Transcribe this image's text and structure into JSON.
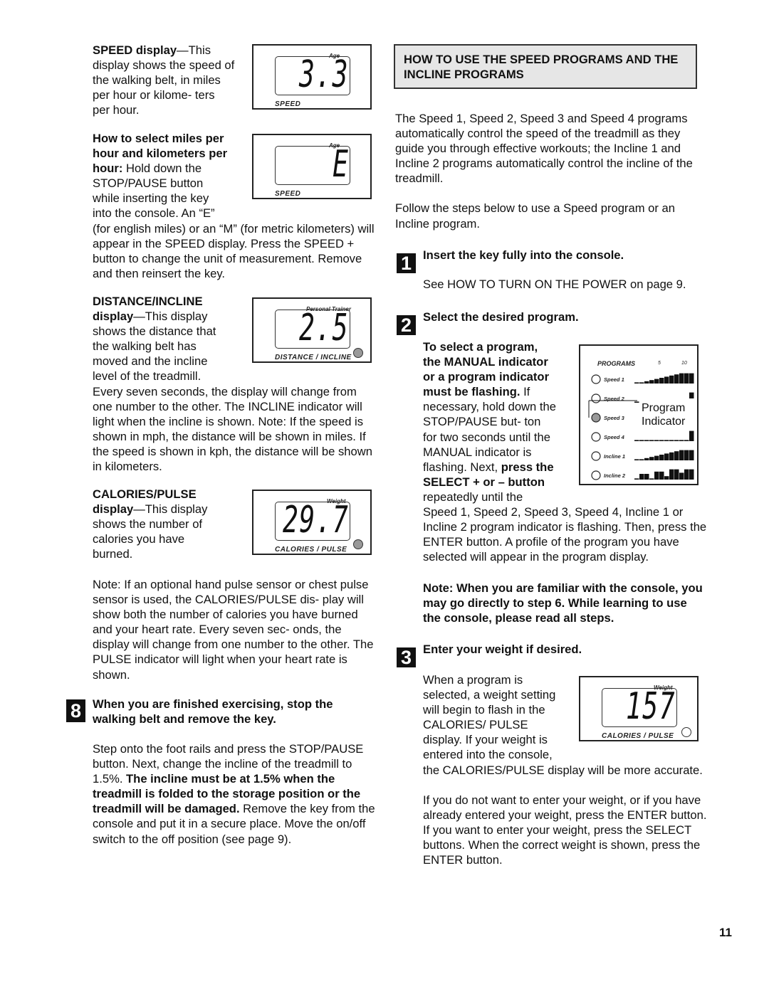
{
  "page_number": "11",
  "left": {
    "speed_display": {
      "heading": "SPEED display",
      "body": "—This display shows the speed of the walking belt, in miles per hour or kilome- ters per hour.",
      "figure1": {
        "top_label": "Age",
        "digits": "3.3",
        "bottom_label": "SPEED"
      },
      "figure2": {
        "top_label": "Age",
        "digits": "E",
        "bottom_label": "SPEED"
      }
    },
    "units": {
      "bold": "How to select miles per hour and kilometers per hour:",
      "body": " Hold down the STOP/PAUSE button while inserting the key into the console. An “E” (for english miles) or an “M” (for metric kilometers) will appear in the SPEED display. Press the SPEED + button to change the unit of measurement. Remove and then reinsert the key."
    },
    "distance": {
      "heading": "DISTANCE/INCLINE",
      "heading2": "display",
      "body": "—This display shows the distance that the walking belt has moved and the incline level of the treadmill.",
      "body2": "Every seven seconds, the display will change from one number to the other. The INCLINE indicator will light when the incline is shown. Note: If the speed is shown in mph, the distance will be shown in miles. If the speed is shown in kph, the distance will be shown in kilometers.",
      "figure": {
        "top_label": "Personal Trainer",
        "digits": "2.5",
        "bottom_label": "DISTANCE / INCLINE"
      }
    },
    "calories": {
      "heading": "CALORIES/PULSE",
      "heading2": "display",
      "body": "—This display shows the number of calories you have burned.",
      "figure": {
        "top_label": "Weight",
        "digits": "29.7",
        "bottom_label": "CALORIES / PULSE"
      },
      "note": "Note: If an optional hand pulse sensor or chest pulse sensor is used, the CALORIES/PULSE dis- play will show both the number of calories you have burned and your heart rate. Every seven sec- onds, the display will change from one number to the other. The PULSE indicator will light when your heart rate is shown."
    },
    "step8": {
      "number": "8",
      "title": "When you are finished exercising, stop the walking belt and remove the key.",
      "body_a": "Step onto the foot rails and press the STOP/PAUSE button. Next, change the incline of the treadmill to 1.5%. ",
      "body_bold": "The incline must be at 1.5% when the treadmill is folded to the storage position or the treadmill will be damaged.",
      "body_b": " Remove the key from the console and put it in a secure place. Move the on/off switch to the off position (see page 9)."
    }
  },
  "right": {
    "heading": "HOW TO USE THE SPEED PROGRAMS AND THE INCLINE PROGRAMS",
    "intro1": "The Speed 1, Speed 2, Speed 3 and Speed 4 programs automatically control the speed of the treadmill as they guide you through effective workouts; the Incline 1 and Incline 2 programs automatically control the incline of the treadmill.",
    "intro2": "Follow the steps below to use a Speed program or an Incline program.",
    "step1": {
      "number": "1",
      "title": "Insert the key fully into the console.",
      "body": "See HOW TO TURN ON THE POWER on page 9."
    },
    "step2": {
      "number": "2",
      "title": "Select the desired program.",
      "bold1": "To select a program, the MANUAL indicator or a program indicator must be flashing.",
      "text1": " If necessary, hold down the STOP/PAUSE but- ton for two seconds until the MANUAL indicator is flashing. Next, ",
      "bold2": "press the SELECT + or – button",
      "text2": " repeatedly until the Speed 1, Speed 2, Speed 3, Speed 4, Incline 1 or Incline 2 program indicator is flashing. Then, press the ENTER button. A profile of the program you have selected will appear in the program display.",
      "note": "Note: When you are familiar with the console, you may go directly to step 6. While learning to use the console, please read all steps.",
      "figure": {
        "title": "PROGRAMS",
        "ticks": [
          "5",
          "10"
        ],
        "callout": [
          "Program",
          "Indicator"
        ],
        "programs": [
          {
            "label": "Speed 1",
            "lit": false
          },
          {
            "label": "Speed 2",
            "lit": false
          },
          {
            "label": "Speed 3",
            "lit": true
          },
          {
            "label": "Speed 4",
            "lit": false
          },
          {
            "label": "Incline 1",
            "lit": false
          },
          {
            "label": "Incline 2",
            "lit": false
          }
        ]
      }
    },
    "step3": {
      "number": "3",
      "title": "Enter your weight if desired.",
      "body1": "When a program is selected, a weight setting will begin to flash in the CALORIES/ PULSE display. If your weight is entered into the console, the CALORIES/PULSE display will be more accurate.",
      "body2": "If you do not want to enter your weight, or if you have already entered your weight, press the ENTER button. If you want to enter your weight, press the SELECT buttons. When the correct weight is shown, press the ENTER button.",
      "figure": {
        "top_label": "Weight",
        "digits": "157",
        "bottom_label": "CALORIES / PULSE"
      }
    }
  }
}
